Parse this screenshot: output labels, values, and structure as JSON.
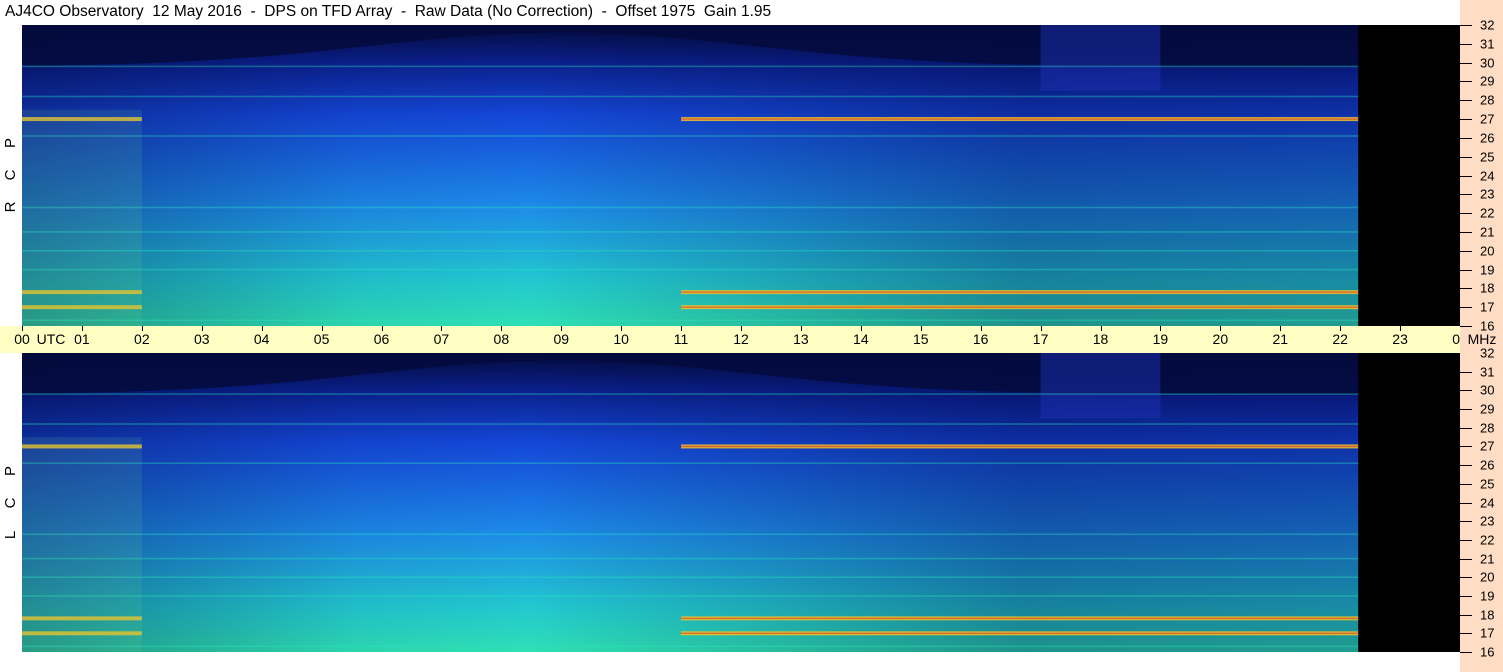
{
  "title": "AJ4CO Observatory  12 May 2016  -  DPS on TFD Array  -  Raw Data (No Correction)  -  Offset 1975  Gain 1.95",
  "chart_data": {
    "type": "heatmap",
    "title": "AJ4CO Observatory  12 May 2016  -  DPS on TFD Array  -  Raw Data (No Correction)  -  Offset 1975  Gain 1.95",
    "x_axis": {
      "unit_label": "UTC",
      "ticks": [
        "00",
        "01",
        "02",
        "03",
        "04",
        "05",
        "06",
        "07",
        "08",
        "09",
        "10",
        "11",
        "12",
        "13",
        "14",
        "15",
        "16",
        "17",
        "18",
        "19",
        "20",
        "21",
        "22",
        "23",
        "00"
      ],
      "range_hours": [
        0,
        24
      ],
      "data_end_hours": 22.3
    },
    "y_axis": {
      "unit_label": "MHz",
      "ticks": [
        "32",
        "31",
        "30",
        "29",
        "28",
        "27",
        "26",
        "25",
        "24",
        "23",
        "22",
        "21",
        "20",
        "19",
        "18",
        "17",
        "16"
      ],
      "range_mhz": [
        16,
        32
      ]
    },
    "panels": [
      {
        "polarization": [
          "R",
          "C",
          "P"
        ],
        "name": "RCP"
      },
      {
        "polarization": [
          "L",
          "C",
          "P"
        ],
        "name": "LCP"
      }
    ],
    "features": {
      "strong_bands_mhz": [
        27.0,
        17.8,
        17.0
      ],
      "weaker_bands_mhz": [
        29.8,
        28.2,
        26.1,
        22.3,
        21.0,
        20.0,
        19.0,
        16.3
      ],
      "daytime_bands_hours": [
        11,
        22.3
      ],
      "night_bands_hours": [
        0,
        2
      ]
    },
    "colors": {
      "background": "#000000",
      "low": "#06124a",
      "mid": "#1a5cf0",
      "high": "#2be8c4",
      "hot": "#f2c026"
    }
  }
}
